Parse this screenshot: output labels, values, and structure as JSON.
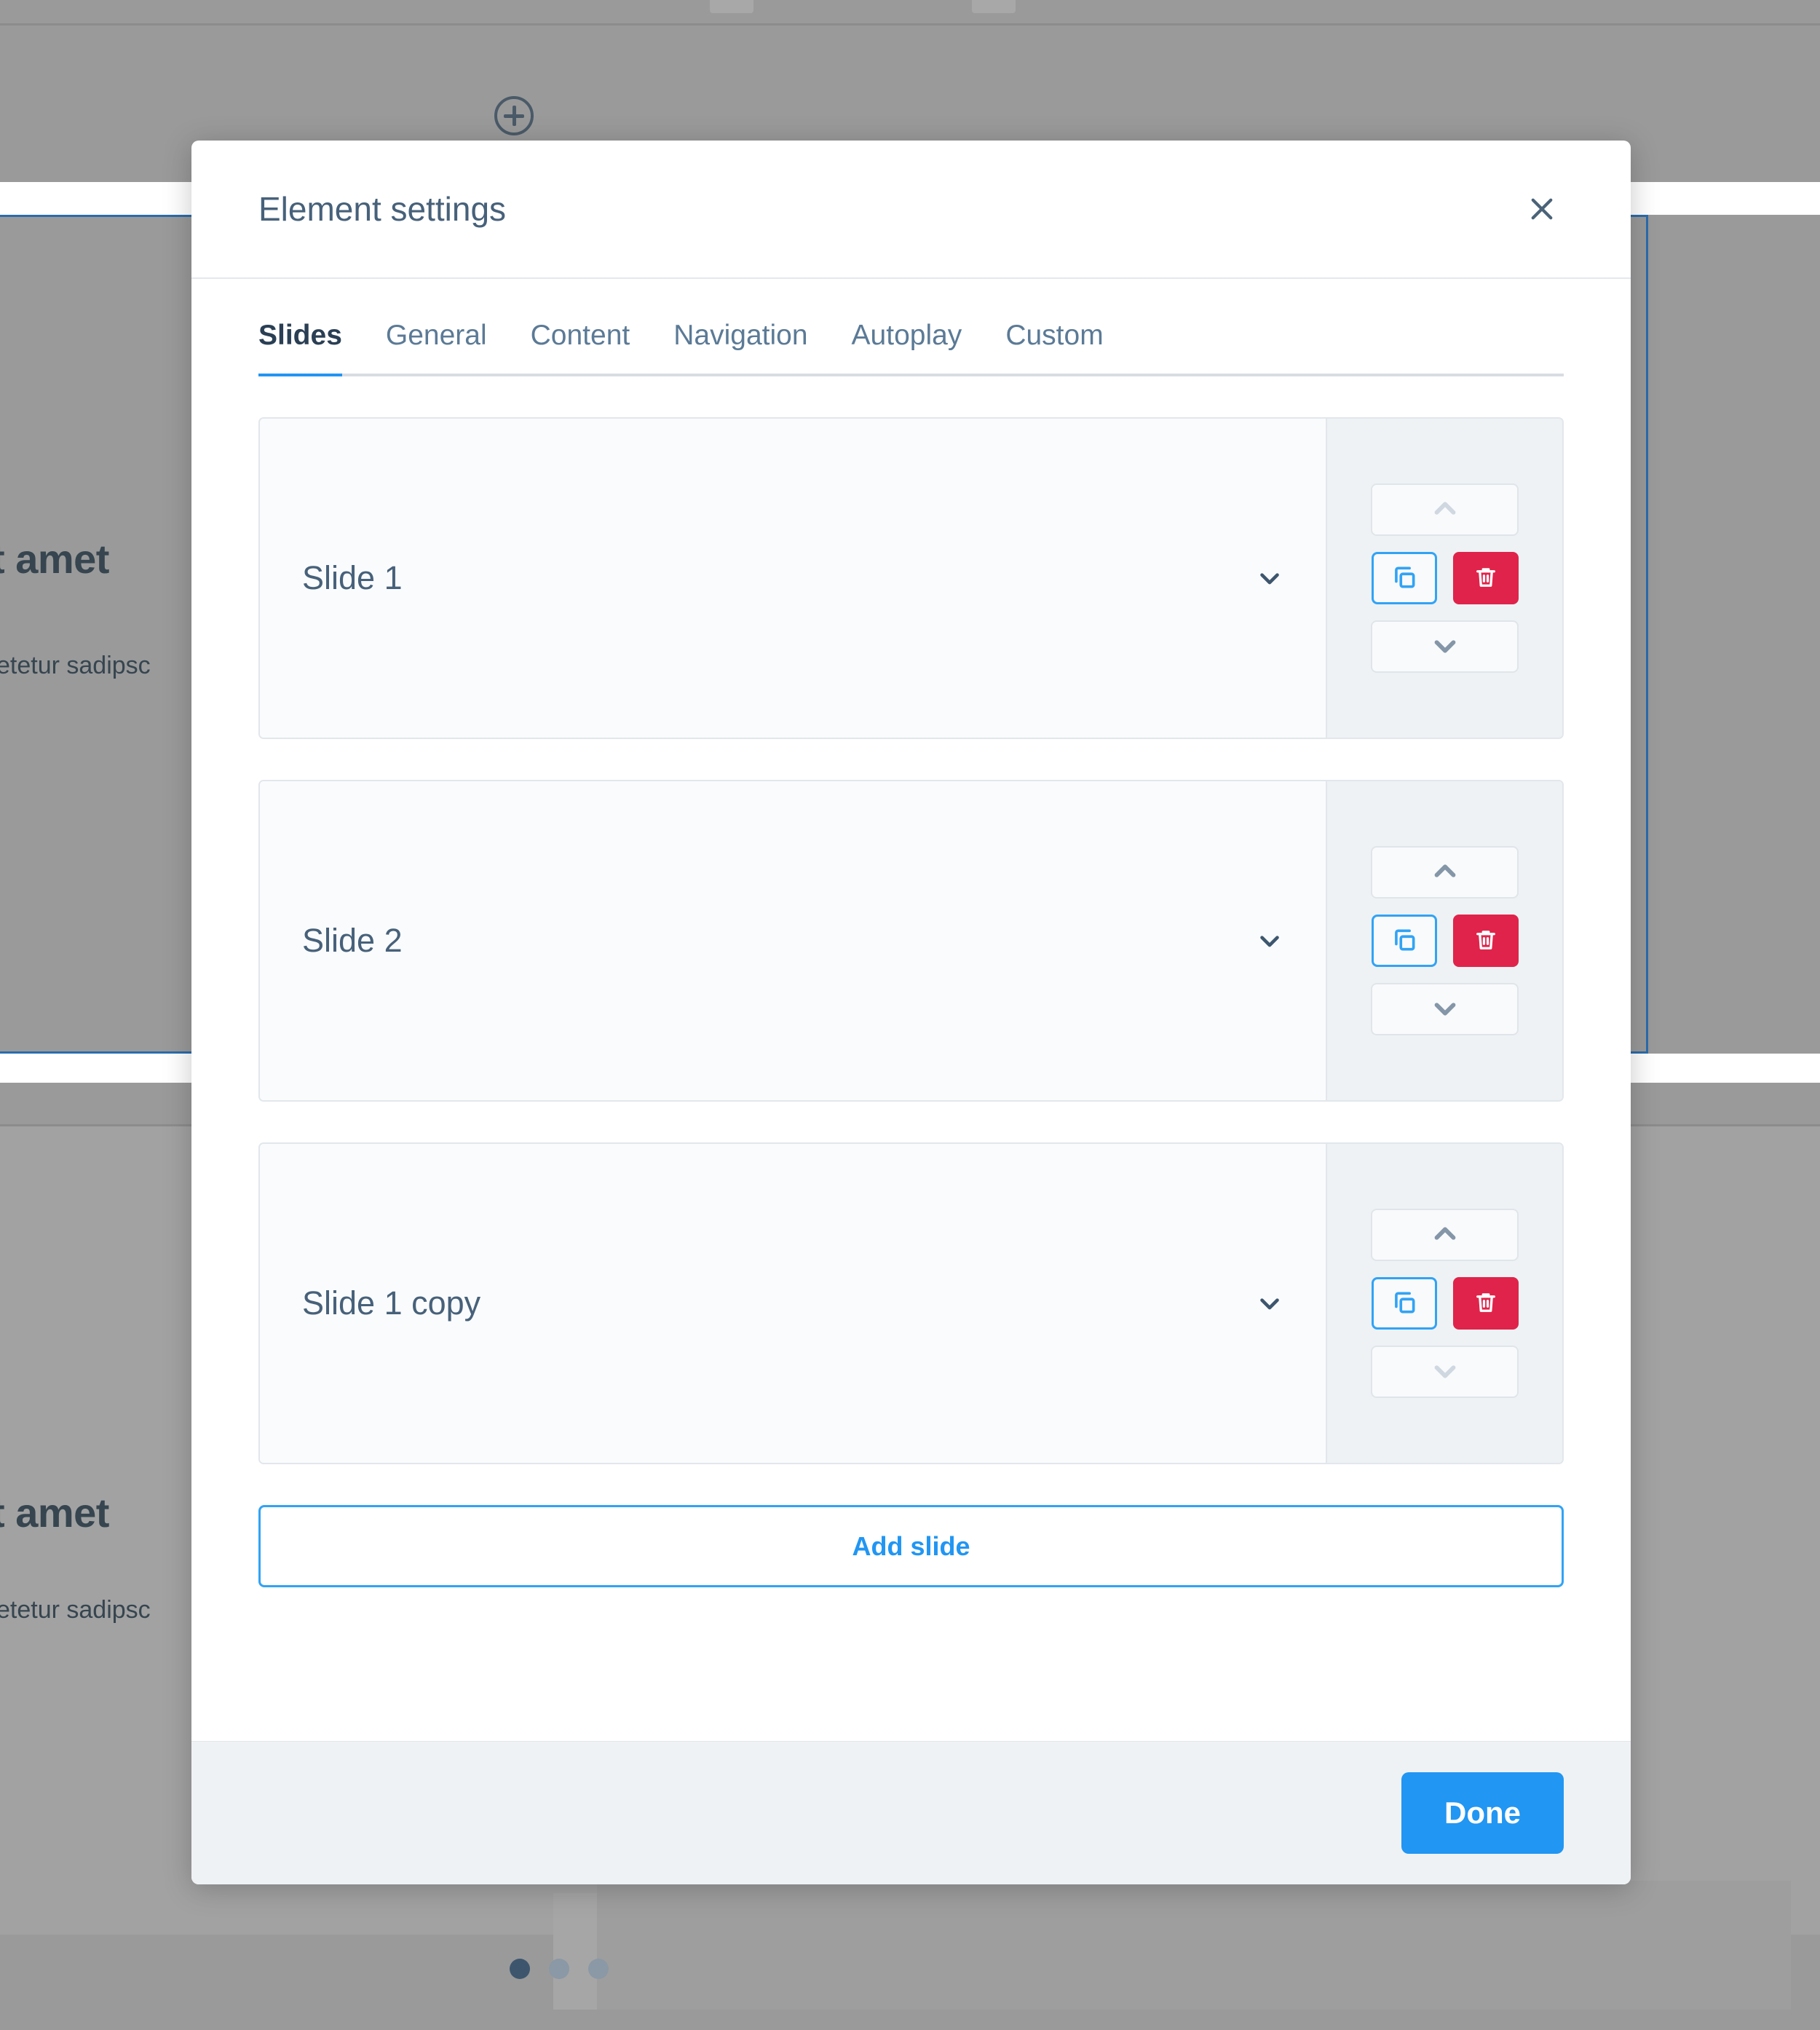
{
  "background": {
    "heading_text": "t amet",
    "sub_text": "setetur sadipsc",
    "add_section_icon": "plus-circle-icon",
    "pagination": {
      "dots": [
        "active",
        "inactive",
        "inactive"
      ],
      "active_index": 0
    },
    "selection_border_color": "#2b6cac",
    "overlay_color": "#9a9a9a"
  },
  "modal": {
    "title": "Element settings",
    "close_icon": "close-icon",
    "tabs": [
      {
        "label": "Slides",
        "active": true
      },
      {
        "label": "General",
        "active": false
      },
      {
        "label": "Content",
        "active": false
      },
      {
        "label": "Navigation",
        "active": false
      },
      {
        "label": "Autoplay",
        "active": false
      },
      {
        "label": "Custom",
        "active": false
      }
    ],
    "slides": [
      {
        "label": "Slide 1",
        "expand_icon": "chevron-down-icon",
        "move_up": {
          "icon": "chevron-up-icon",
          "disabled": true
        },
        "move_down": {
          "icon": "chevron-down-icon",
          "disabled": false
        },
        "duplicate": {
          "icon": "copy-icon"
        },
        "delete": {
          "icon": "trash-icon"
        }
      },
      {
        "label": "Slide 2",
        "expand_icon": "chevron-down-icon",
        "move_up": {
          "icon": "chevron-up-icon",
          "disabled": false
        },
        "move_down": {
          "icon": "chevron-down-icon",
          "disabled": false
        },
        "duplicate": {
          "icon": "copy-icon"
        },
        "delete": {
          "icon": "trash-icon"
        }
      },
      {
        "label": "Slide 1 copy",
        "expand_icon": "chevron-down-icon",
        "move_up": {
          "icon": "chevron-up-icon",
          "disabled": false
        },
        "move_down": {
          "icon": "chevron-down-icon",
          "disabled": true
        },
        "duplicate": {
          "icon": "copy-icon"
        },
        "delete": {
          "icon": "trash-icon"
        }
      }
    ],
    "add_slide_label": "Add slide",
    "done_label": "Done"
  },
  "colors": {
    "accent_blue": "#2196f3",
    "danger_red": "#e0234a",
    "title_slate": "#47617a",
    "tab_active": "#2a3f54",
    "panel_gray": "#eef2f5",
    "footer_gray": "#eff2f5"
  }
}
